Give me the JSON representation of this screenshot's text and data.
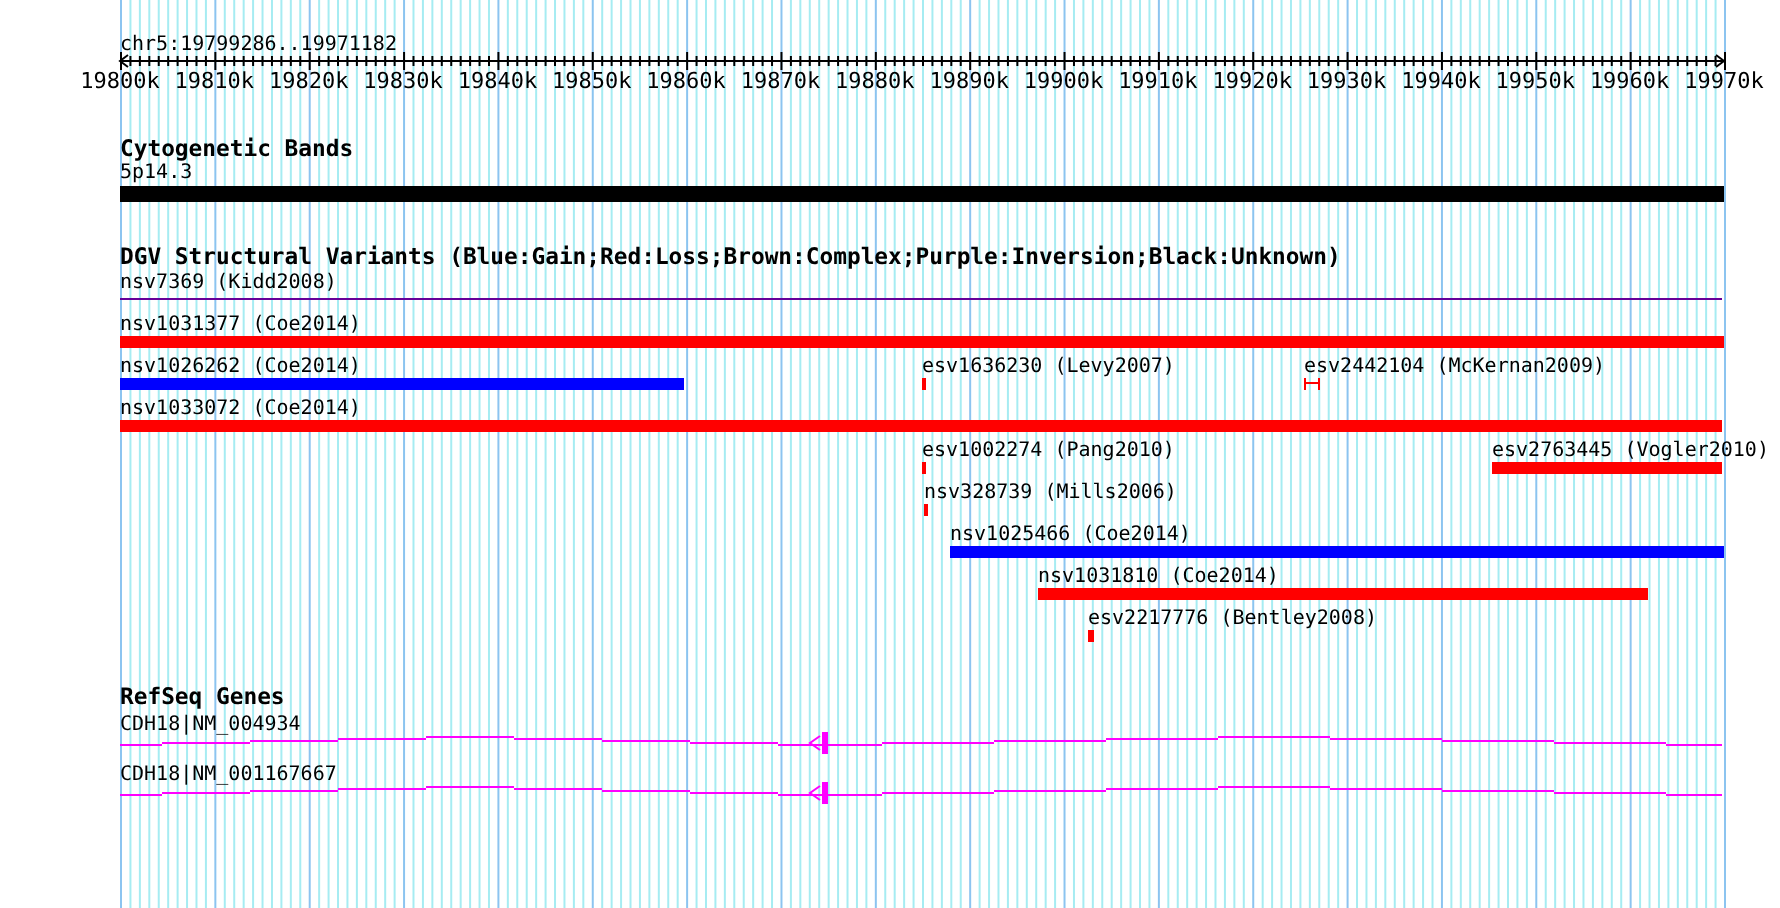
{
  "ruler": {
    "location": "chr5:19799286..19971182",
    "ticks": [
      "19800k",
      "19810k",
      "19820k",
      "19830k",
      "19840k",
      "19850k",
      "19860k",
      "19870k",
      "19880k",
      "19890k",
      "19900k",
      "19910k",
      "19920k",
      "19930k",
      "19940k",
      "19950k",
      "19960k",
      "19970k"
    ]
  },
  "tracks": [
    {
      "title": "Cytogenetic Bands",
      "kind": "bands",
      "features": [
        {
          "label": "5p14.3",
          "color": "#000000"
        }
      ]
    },
    {
      "title": "DGV Structural Variants (Blue:Gain;Red:Loss;Brown:Complex;Purple:Inversion;Black:Unknown)",
      "kind": "variants",
      "features": [
        {
          "label": "nsv7369 (Kidd2008)",
          "color": "#660099",
          "kind": "line"
        },
        {
          "label": "nsv1031377 (Coe2014)",
          "color": "#ff0000",
          "kind": "bar"
        },
        {
          "label": "nsv1026262 (Coe2014)",
          "color": "#0000ff",
          "kind": "bar"
        },
        {
          "label": "esv1636230 (Levy2007)",
          "color": "#ff0000",
          "kind": "bar"
        },
        {
          "label": "esv2442104 (McKernan2009)",
          "color": "#ff0000",
          "kind": "bracket"
        },
        {
          "label": "nsv1033072 (Coe2014)",
          "color": "#ff0000",
          "kind": "bar"
        },
        {
          "label": "esv1002274 (Pang2010)",
          "color": "#ff0000",
          "kind": "bar"
        },
        {
          "label": "esv2763445 (Vogler2010)",
          "color": "#ff0000",
          "kind": "bar"
        },
        {
          "label": "nsv328739 (Mills2006)",
          "color": "#ff0000",
          "kind": "bar"
        },
        {
          "label": "nsv1025466 (Coe2014)",
          "color": "#0000ff",
          "kind": "bar"
        },
        {
          "label": "nsv1031810 (Coe2014)",
          "color": "#ff0000",
          "kind": "bar"
        },
        {
          "label": "esv2217776 (Bentley2008)",
          "color": "#ff0000",
          "kind": "bar"
        }
      ]
    },
    {
      "title": "RefSeq Genes",
      "kind": "genes",
      "features": [
        {
          "label": "CDH18|NM_004934"
        },
        {
          "label": "CDH18|NM_001167667"
        }
      ]
    }
  ]
}
